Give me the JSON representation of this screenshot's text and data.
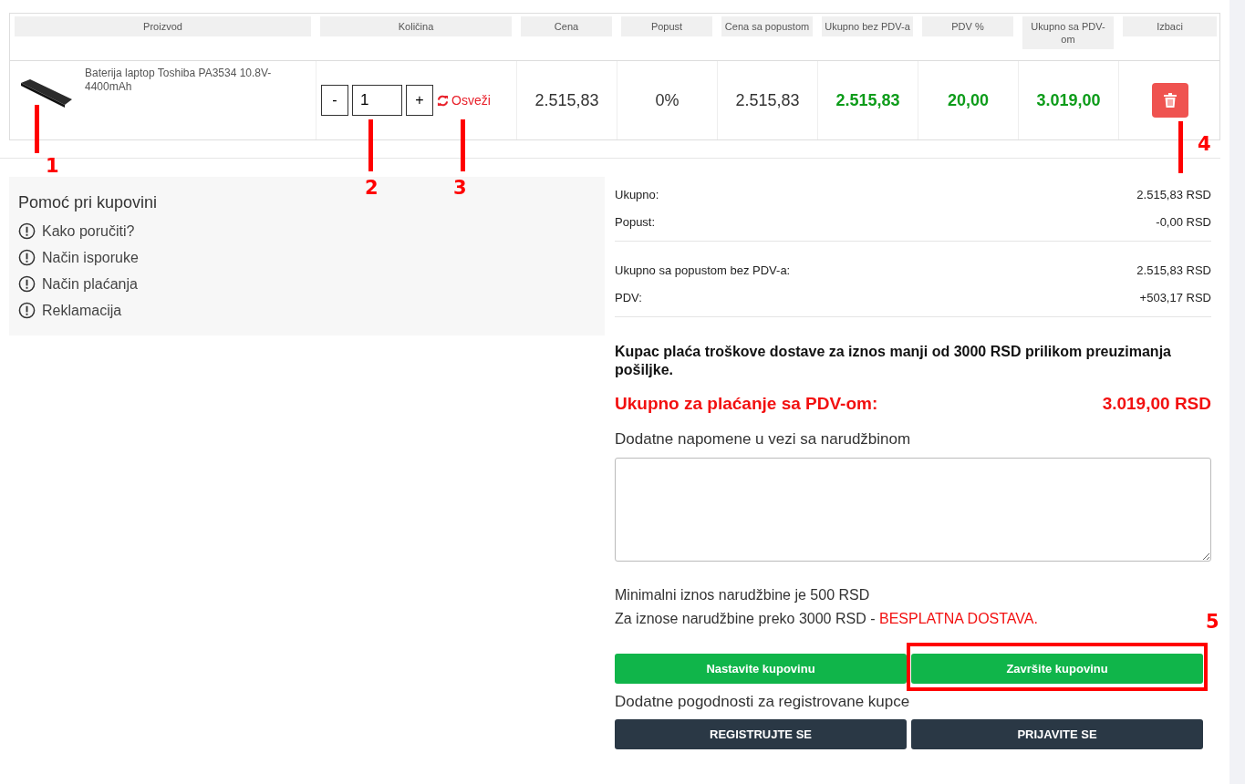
{
  "cart": {
    "columns": [
      {
        "label": "Proizvod"
      },
      {
        "label": "Količina"
      },
      {
        "label": "Cena"
      },
      {
        "label": "Popust"
      },
      {
        "label": "Cena sa popustom"
      },
      {
        "label": "Ukupno bez PDV-a"
      },
      {
        "label": "PDV %"
      },
      {
        "label": "Ukupno sa PDV-om"
      },
      {
        "label": "Izbaci"
      }
    ],
    "row": {
      "product": "Baterija laptop Toshiba PA3534 10.8V-4400mAh",
      "decrease": "-",
      "quantity": "1",
      "increase": "+",
      "refresh": "Osveži",
      "cells": [
        {
          "text": "2.515,83",
          "kind": "plain"
        },
        {
          "text": "0%",
          "kind": "plain"
        },
        {
          "text": "2.515,83",
          "kind": "plain"
        },
        {
          "text": "2.515,83",
          "kind": "green"
        },
        {
          "text": "20,00",
          "kind": "green"
        },
        {
          "text": "3.019,00",
          "kind": "green"
        }
      ]
    }
  },
  "help": {
    "title": "Pomoć pri kupovini",
    "items": [
      {
        "label": "Kako poručiti?"
      },
      {
        "label": "Način isporuke"
      },
      {
        "label": "Način plaćanja"
      },
      {
        "label": "Reklamacija"
      }
    ]
  },
  "summary": {
    "groups": [
      [
        {
          "label": "Ukupno:",
          "value": "2.515,83 RSD"
        },
        {
          "label": "Popust:",
          "value": "-0,00 RSD"
        }
      ],
      [
        {
          "label": "Ukupno sa popustom bez PDV-a:",
          "value": "2.515,83 RSD"
        },
        {
          "label": "PDV:",
          "value": "+503,17 RSD"
        }
      ]
    ],
    "shipping_note": "Kupac plaća troškove dostave za iznos manji od 3000 RSD prilikom preuzimanja pošiljke.",
    "total": {
      "label": "Ukupno za plaćanje sa PDV-om:",
      "value": "3.019,00 RSD"
    },
    "notes_label": "Dodatne napomene u vezi sa narudžbinom",
    "minimum": "Minimalni iznos narudžbine je 500 RSD",
    "free_shipping": {
      "text": "Za iznose narudžbine preko 3000 RSD -",
      "emphasis": "BESPLATNA DOSTAVA."
    },
    "actions": [
      {
        "label": "Nastavite kupovinu",
        "kind": "green"
      },
      {
        "label": "Završite kupovinu",
        "kind": "green"
      }
    ],
    "registered_note": "Dodatne pogodnosti za registrovane kupce",
    "account_actions": [
      {
        "label": "REGISTRUJTE SE",
        "kind": "dark"
      },
      {
        "label": "PRIJAVITE SE",
        "kind": "dark"
      }
    ]
  },
  "callouts": [
    {
      "label": "1",
      "kind": "line"
    },
    {
      "label": "2",
      "kind": "line"
    },
    {
      "label": "3",
      "kind": "line"
    },
    {
      "label": "4",
      "kind": "line"
    },
    {
      "label": "5",
      "kind": "frame"
    }
  ]
}
